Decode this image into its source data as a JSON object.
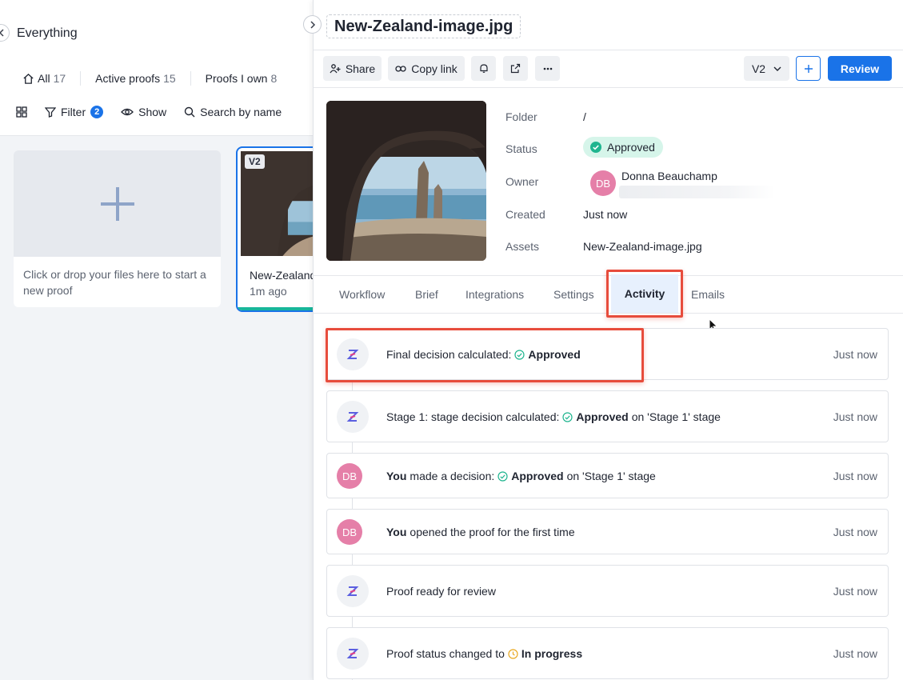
{
  "left": {
    "workspace_title": "Everything",
    "filter_tabs": [
      {
        "label": "All",
        "count": "17"
      },
      {
        "label": "Active proofs",
        "count": "15"
      },
      {
        "label": "Proofs I own",
        "count": "8"
      }
    ],
    "toolbar": {
      "filter_label": "Filter",
      "filter_count": "2",
      "show_label": "Show",
      "search_placeholder": "Search by name"
    },
    "new_proof_text": "Click or drop your files here to start a new proof",
    "proof_card": {
      "version": "V2",
      "name": "New-Zealand-image.jpg",
      "time": "1m ago"
    }
  },
  "right": {
    "file_title": "New-Zealand-image.jpg",
    "actions": {
      "share": "Share",
      "copy_link": "Copy link",
      "version": "V2",
      "review": "Review"
    },
    "meta": {
      "folder_label": "Folder",
      "folder_value": "/",
      "status_label": "Status",
      "status_value": "Approved",
      "owner_label": "Owner",
      "owner_initials": "DB",
      "owner_name": "Donna Beauchamp",
      "created_label": "Created",
      "created_value": "Just now",
      "assets_label": "Assets",
      "assets_value": "New-Zealand-image.jpg"
    },
    "tabs": [
      "Workflow",
      "Brief",
      "Integrations",
      "Settings",
      "Activity",
      "Emails"
    ],
    "active_tab": "Activity",
    "activity": [
      {
        "type": "system",
        "pre": "Final decision calculated:",
        "status": "Approved",
        "post": "",
        "time": "Just now"
      },
      {
        "type": "system",
        "pre": "Stage 1: stage decision calculated:",
        "status": "Approved",
        "post": "on 'Stage 1' stage",
        "time": "Just now"
      },
      {
        "type": "user",
        "initials": "DB",
        "bold": "You",
        "pre": "made a decision:",
        "status": "Approved",
        "post": "on 'Stage 1' stage",
        "time": "Just now"
      },
      {
        "type": "user",
        "initials": "DB",
        "bold": "You",
        "pre": "opened the proof for the first time",
        "time": "Just now"
      },
      {
        "type": "system",
        "pre": "Proof ready for review",
        "time": "Just now"
      },
      {
        "type": "system",
        "pre": "Proof status changed to",
        "status": "In progress",
        "time": "Just now"
      }
    ],
    "colors": {
      "accent": "#1a73e8",
      "approved": "#1fb58f",
      "in_progress": "#e9a820",
      "highlight": "#e74c3c"
    }
  }
}
